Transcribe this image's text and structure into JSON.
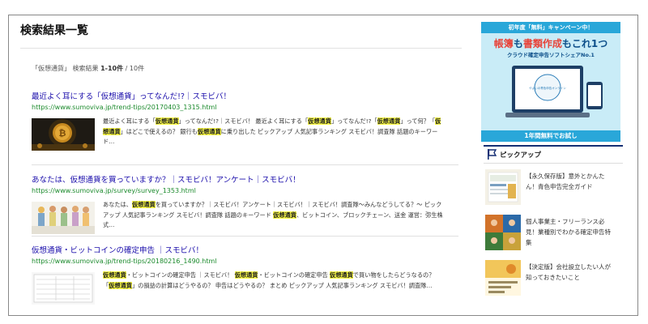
{
  "page": {
    "title": "検索結果一覧"
  },
  "search": {
    "summary_query": "「仮想通貨」",
    "summary_label": "検索結果",
    "summary_range": "1-10件",
    "summary_total": " / 10件"
  },
  "results": [
    {
      "title": "最近よく耳にする「仮想通貨」ってなんだ!?｜スモビバ！",
      "url": "https://www.sumoviva.jp/trend-tips/20170403_1315.html",
      "snippet_segments": [
        {
          "t": "最近よく耳にする「",
          "h": false
        },
        {
          "t": "仮想通貨",
          "h": true
        },
        {
          "t": "」ってなんだ!?｜スモビバ！ 最近よく耳にする「",
          "h": false
        },
        {
          "t": "仮想通貨",
          "h": true
        },
        {
          "t": "」ってなんだ!?「",
          "h": false
        },
        {
          "t": "仮想通貨",
          "h": true
        },
        {
          "t": "」って何？「",
          "h": false
        },
        {
          "t": "仮想通貨",
          "h": true
        },
        {
          "t": "」はどこで使えるの？ 銀行も",
          "h": false
        },
        {
          "t": "仮想通貨",
          "h": true
        },
        {
          "t": "に乗り出した ピックアップ 人気記事ランキング スモビバ！調査隊 話題のキーワード…",
          "h": false
        }
      ]
    },
    {
      "title": "あなたは、仮想通貨を買っていますか？｜スモビバ！アンケート｜スモビバ！",
      "url": "https://www.sumoviva.jp/survey/survey_1353.html",
      "snippet_segments": [
        {
          "t": "あなたは、",
          "h": false
        },
        {
          "t": "仮想通貨",
          "h": true
        },
        {
          "t": "を買っていますか？｜スモビバ！アンケート｜スモビバ！｜スモビバ！調査隊〜みんなどうしてる？〜 ピックアップ 人気記事ランキング スモビバ！調査隊 話題のキーワード ",
          "h": false
        },
        {
          "t": "仮想通貨",
          "h": true
        },
        {
          "t": "、ビットコイン、ブロックチェーン、送金 運営：弥生株式…",
          "h": false
        }
      ]
    },
    {
      "title": "仮想通貨・ビットコインの確定申告 ｜スモビバ！",
      "url": "https://www.sumoviva.jp/trend-tips/20180216_1490.html",
      "snippet_segments": [
        {
          "t": "仮想通貨",
          "h": true
        },
        {
          "t": "・ビットコインの確定申告 ｜スモビバ！ ",
          "h": false
        },
        {
          "t": "仮想通貨",
          "h": true
        },
        {
          "t": "・ビットコインの確定申告 ",
          "h": false
        },
        {
          "t": "仮想通貨",
          "h": true
        },
        {
          "t": "で買い物をしたらどうなるの？「",
          "h": false
        },
        {
          "t": "仮想通貨",
          "h": true
        },
        {
          "t": "」の損益の計算はどうやるの？ 申告はどうやるの？ まとめ ピックアップ 人気記事ランキング スモビバ！調査隊…",
          "h": false
        }
      ]
    }
  ],
  "ad": {
    "top": "初年度「無料」キャンペーン中！",
    "line1_a": "帳簿",
    "line1_b": "も",
    "line1_c": "書類作成",
    "line1_d": "もこれ1つ",
    "line2": "クラウド確定申告ソフトシェアNo.1",
    "screen_text": "やよいの青色申告オンライン",
    "bottom": "1年間無料でお試し"
  },
  "pickup": {
    "title": "ピックアップ",
    "items": [
      {
        "text": "【永久保存版】意外とかんたん！青色申告完全ガイド"
      },
      {
        "text": "個人事業主・フリーランス必見！業種別でわかる確定申告特集"
      },
      {
        "text": "【決定版】会社設立したい人が知っておきたいこと"
      }
    ]
  },
  "colors": {
    "title_link": "#1a0dab",
    "url_green": "#1b8a2c",
    "highlight": "#ffff47",
    "ad_blue": "#29a7d9",
    "pickup_navy": "#152f74"
  }
}
